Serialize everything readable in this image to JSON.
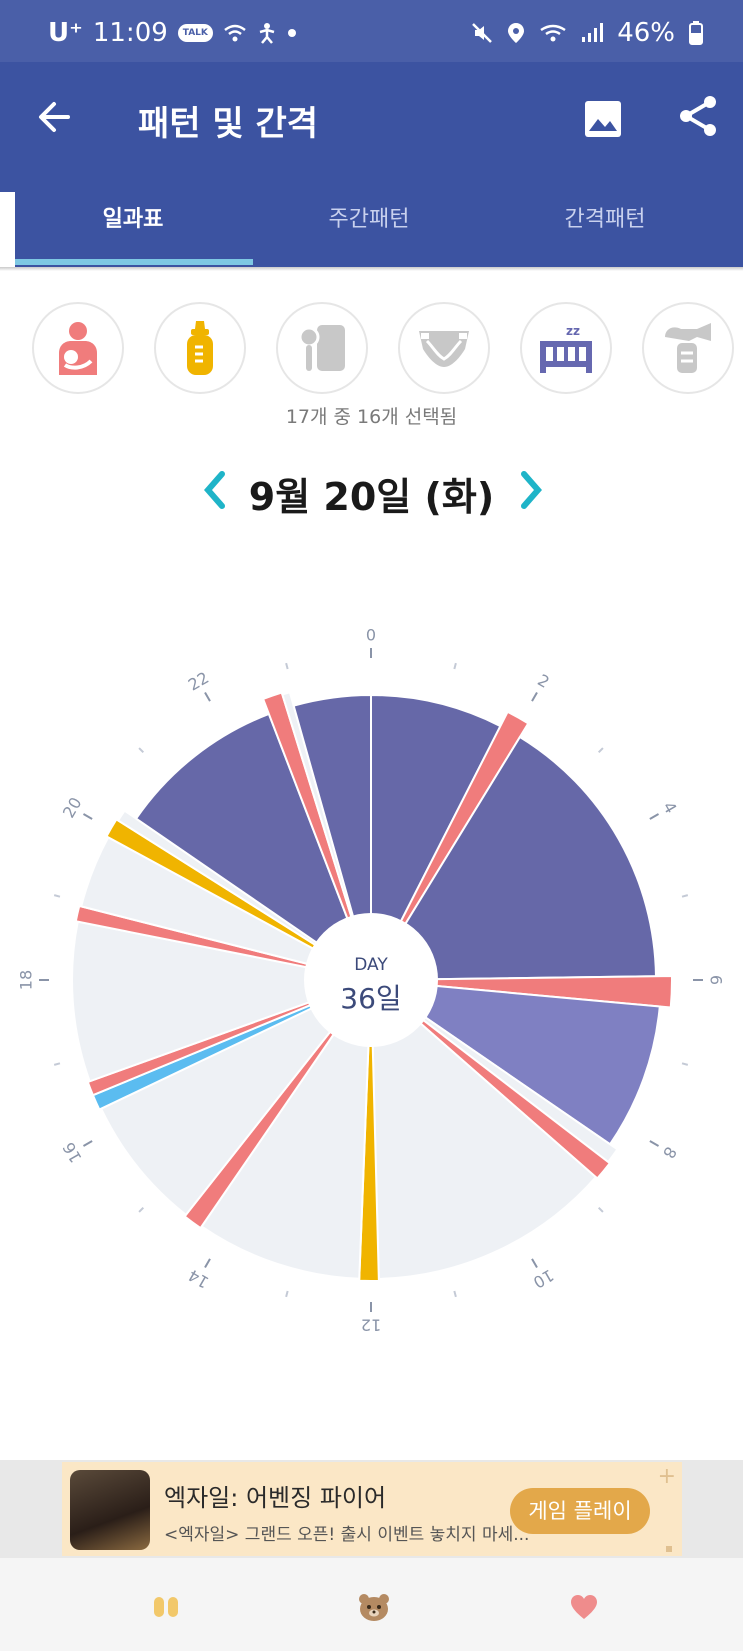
{
  "status_bar": {
    "carrier": "U⁺",
    "time": "11:09",
    "talk_badge": "TALK",
    "battery": "46%"
  },
  "app_bar": {
    "title": "패턴 및 간격",
    "back_icon": "arrow-left-icon",
    "image_icon": "image-icon",
    "share_icon": "share-icon"
  },
  "tabs": [
    {
      "label": "일과표",
      "active": true
    },
    {
      "label": "주간패턴",
      "active": false
    },
    {
      "label": "간격패턴",
      "active": false
    }
  ],
  "categories": [
    {
      "icon": "breastfeeding-icon",
      "color": "#f07c7c"
    },
    {
      "icon": "bottle-icon",
      "color": "#f0b400"
    },
    {
      "icon": "baby-food-icon",
      "color": "#c8c8c8"
    },
    {
      "icon": "diaper-icon",
      "color": "#c8c8c8"
    },
    {
      "icon": "sleep-crib-icon",
      "color": "#6668b0"
    },
    {
      "icon": "breast-pump-icon",
      "color": "#c8c8c8"
    }
  ],
  "selection_info": "17개 중 16개 선택됨",
  "date_nav": {
    "date": "9월 20일 (화)",
    "prev_icon": "chevron-left-icon",
    "next_icon": "chevron-right-icon",
    "accent": "#1fb4c8"
  },
  "chart_data": {
    "type": "radial-timeline",
    "center_label": "DAY",
    "center_value": "36일",
    "hour_labels": [
      "0",
      "2",
      "4",
      "6",
      "8",
      "10",
      "12",
      "14",
      "16",
      "18",
      "20",
      "22"
    ],
    "colors": {
      "sleep_night": "#6668a8",
      "sleep_day": "#7f80c2",
      "breastfeeding": "#f07c7c",
      "bottle": "#f0b400",
      "pumping": "#5bbcf0",
      "awake": "#eef1f5"
    },
    "segments": [
      {
        "type": "sleep_night",
        "start": 0.0,
        "end": 1.8
      },
      {
        "type": "breastfeeding",
        "start": 1.8,
        "end": 2.1
      },
      {
        "type": "sleep_night",
        "start": 2.1,
        "end": 5.95
      },
      {
        "type": "breastfeeding",
        "start": 5.95,
        "end": 6.35
      },
      {
        "type": "sleep_day",
        "start": 6.35,
        "end": 8.3
      },
      {
        "type": "awake",
        "start": 8.3,
        "end": 8.5
      },
      {
        "type": "breastfeeding",
        "start": 8.5,
        "end": 8.75
      },
      {
        "type": "awake",
        "start": 8.75,
        "end": 11.9
      },
      {
        "type": "bottle",
        "start": 11.9,
        "end": 12.15
      },
      {
        "type": "awake",
        "start": 12.15,
        "end": 14.3
      },
      {
        "type": "breastfeeding",
        "start": 14.3,
        "end": 14.55
      },
      {
        "type": "awake",
        "start": 14.55,
        "end": 16.3
      },
      {
        "type": "pumping",
        "start": 16.3,
        "end": 16.5
      },
      {
        "type": "breastfeeding",
        "start": 16.5,
        "end": 16.68
      },
      {
        "type": "awake",
        "start": 16.68,
        "end": 18.75
      },
      {
        "type": "breastfeeding",
        "start": 18.75,
        "end": 18.95
      },
      {
        "type": "awake",
        "start": 18.95,
        "end": 19.9
      },
      {
        "type": "bottle",
        "start": 19.9,
        "end": 20.15
      },
      {
        "type": "awake",
        "start": 20.15,
        "end": 20.3
      },
      {
        "type": "sleep_night",
        "start": 20.3,
        "end": 22.6
      },
      {
        "type": "breastfeeding",
        "start": 22.6,
        "end": 22.85
      },
      {
        "type": "awake",
        "start": 22.85,
        "end": 22.95
      },
      {
        "type": "sleep_night",
        "start": 22.95,
        "end": 24.0
      }
    ]
  },
  "ad": {
    "title": "엑자일: 어벤징 파이어",
    "subtitle": "<엑자일> 그랜드 오픈! 출시 이벤트 놓치지 마세...",
    "button": "게임 플레이",
    "plus": "+"
  },
  "bottom_nav": [
    {
      "icon": "footprints-icon",
      "color": "#f2c86a"
    },
    {
      "icon": "bear-icon",
      "color": "#b48a62"
    },
    {
      "icon": "heart-icon",
      "color": "#ef8c8c"
    }
  ]
}
